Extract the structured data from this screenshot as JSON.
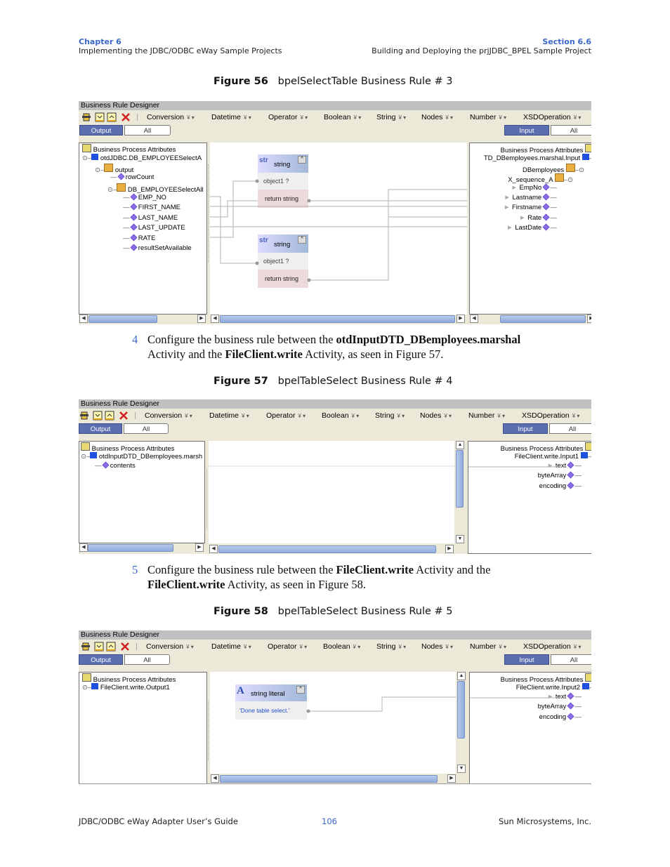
{
  "header": {
    "chapter": "Chapter 6",
    "chapter_title": "Implementing the JDBC/ODBC eWay Sample Projects",
    "section": "Section 6.6",
    "section_title": "Building and Deploying the prjJDBC_BPEL Sample Project"
  },
  "designer_common": {
    "title": "Business Rule Designer",
    "toolbar_icons": [
      "add-rule-icon",
      "move-down-icon",
      "move-up-icon",
      "delete-icon"
    ],
    "menus": [
      "Conversion",
      "Datetime",
      "Operator",
      "Boolean",
      "String",
      "Nodes",
      "Number",
      "XSDOperation"
    ],
    "output_tab": "Output",
    "input_tab": "Input",
    "all_tab": "All",
    "root_label": "Business Process Attributes"
  },
  "figure56": {
    "label": "Figure 56",
    "caption": "bpelSelectTable Business Rule # 3",
    "left_tree": [
      "otdJDBC.DB_EMPLOYEESelectA",
      "output",
      "rowCount",
      "DB_EMPLOYEESelectAll",
      "EMP_NO",
      "FIRST_NAME",
      "LAST_NAME",
      "LAST_UPDATE",
      "RATE",
      "resultSetAvailable"
    ],
    "right_tree": [
      "TD_DBemployees.marshal.Input",
      "DBemployees",
      "X_sequence_A",
      "EmpNo",
      "Lastname",
      "Firstname",
      "Rate",
      "LastDate"
    ],
    "nodes": [
      {
        "tag": "str",
        "title": "string",
        "input": "object1 ?",
        "output": "return string"
      },
      {
        "tag": "str",
        "title": "string",
        "input": "object1 ?",
        "output": "return string"
      }
    ]
  },
  "step4": {
    "number": "4",
    "text_parts": [
      "Configure the business rule between the ",
      "otdInputDTD_DBemployees.marshal",
      " Activity and the ",
      "FileClient.write",
      " Activity, as seen in Figure 57."
    ]
  },
  "figure57": {
    "label": "Figure 57",
    "caption": "bpelTableSelect Business Rule # 4",
    "left_tree": [
      "otdInputDTD_DBemployees.marsh",
      "contents"
    ],
    "right_tree": [
      "FileClient.write.Input1",
      "text",
      "byteArray",
      "encoding"
    ]
  },
  "step5": {
    "number": "5",
    "text_parts": [
      "Configure the business rule between the ",
      "FileClient.write",
      " Activity and the ",
      "FileClient.write",
      " Activity, as seen in Figure 58."
    ]
  },
  "figure58": {
    "label": "Figure 58",
    "caption": "bpelTableSelect Business Rule # 5",
    "left_tree": [
      "FileClient.write.Output1"
    ],
    "right_tree": [
      "FileClient.write.Input2",
      "text",
      "byteArray",
      "encoding"
    ],
    "node": {
      "tag": "A",
      "title": "string literal",
      "value": "'Done table select.'"
    }
  },
  "footer": {
    "guide": "JDBC/ODBC eWay Adapter User’s Guide",
    "page": "106",
    "company": "Sun Microsystems, Inc."
  }
}
